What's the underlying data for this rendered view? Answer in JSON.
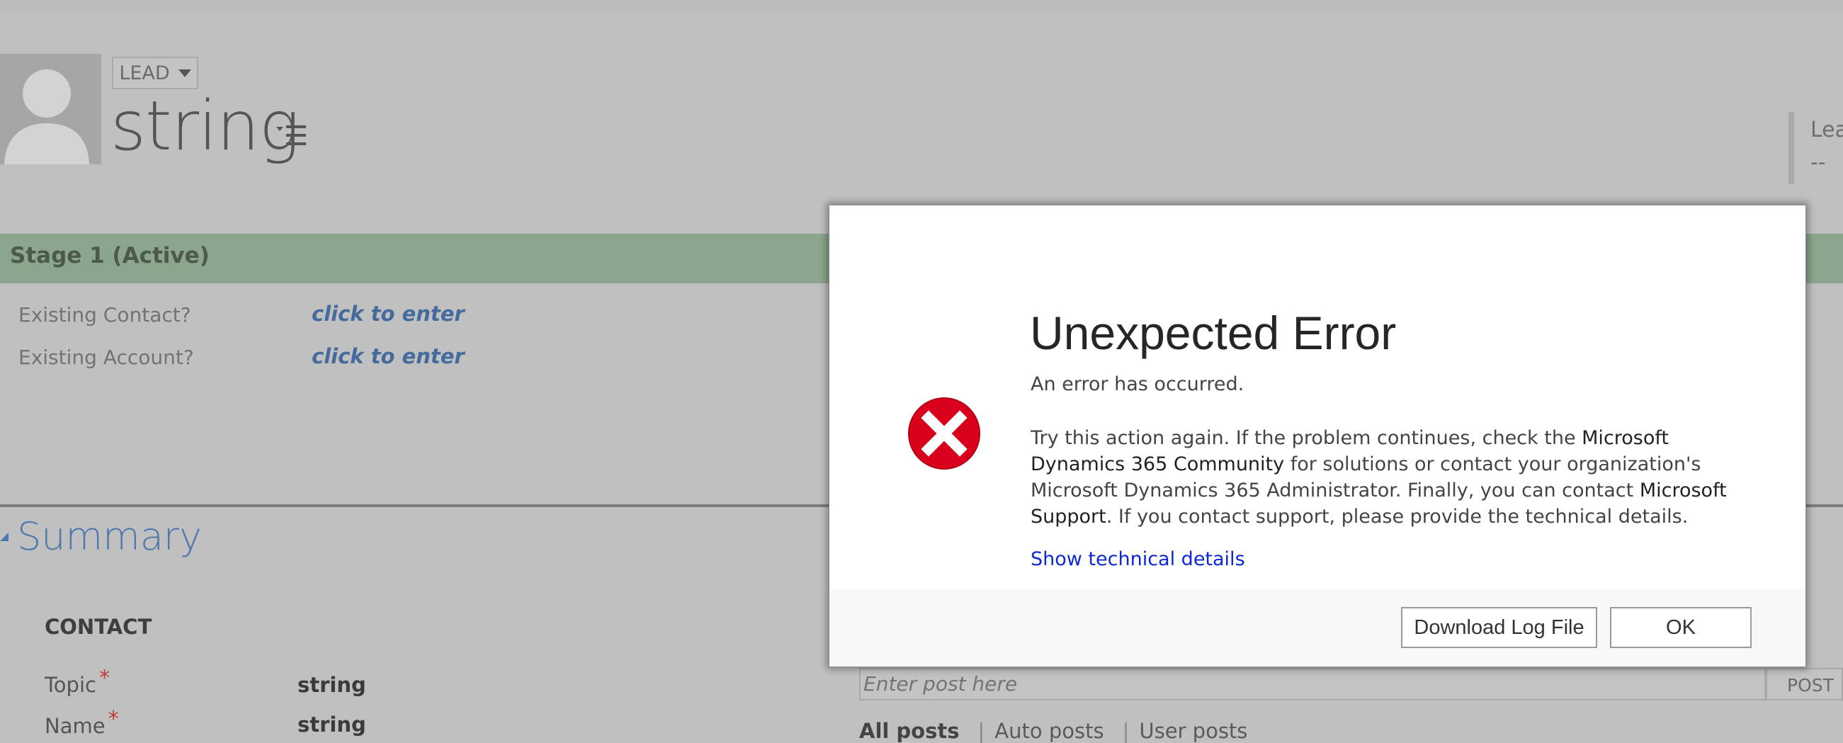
{
  "header": {
    "entity_label": "LEAD",
    "record_title": "string",
    "right_field_label": "Lea",
    "right_field_value": "--"
  },
  "process": {
    "stage_label": "Stage 1 (Active)",
    "fields": [
      {
        "label": "Existing Contact?",
        "value": "click to enter"
      },
      {
        "label": "Existing Account?",
        "value": "click to enter"
      }
    ]
  },
  "summary": {
    "title": "Summary",
    "section": "CONTACT",
    "fields": [
      {
        "label": "Topic",
        "required_mark": "*",
        "value": "string"
      },
      {
        "label": "Name",
        "required_mark": "*",
        "value": "string"
      }
    ]
  },
  "posts": {
    "placeholder": "Enter post here",
    "post_button": "POST",
    "tabs": [
      "All posts",
      "Auto posts",
      "User posts"
    ]
  },
  "dialog": {
    "title": "Unexpected Error",
    "subtitle": "An error has occurred.",
    "body_part1": "Try this action again. If the problem continues, check the ",
    "body_link1": "Microsoft Dynamics 365 Community",
    "body_part2": " for solutions or contact your organization's Microsoft Dynamics 365 Administrator. Finally, you can contact ",
    "body_link2": "Microsoft Support",
    "body_part3": ". If you contact support, please provide the technical details.",
    "show_details": "Show technical details",
    "download_button": "Download Log File",
    "ok_button": "OK",
    "icon": "error-x-icon",
    "icon_color": "#d9001b"
  }
}
